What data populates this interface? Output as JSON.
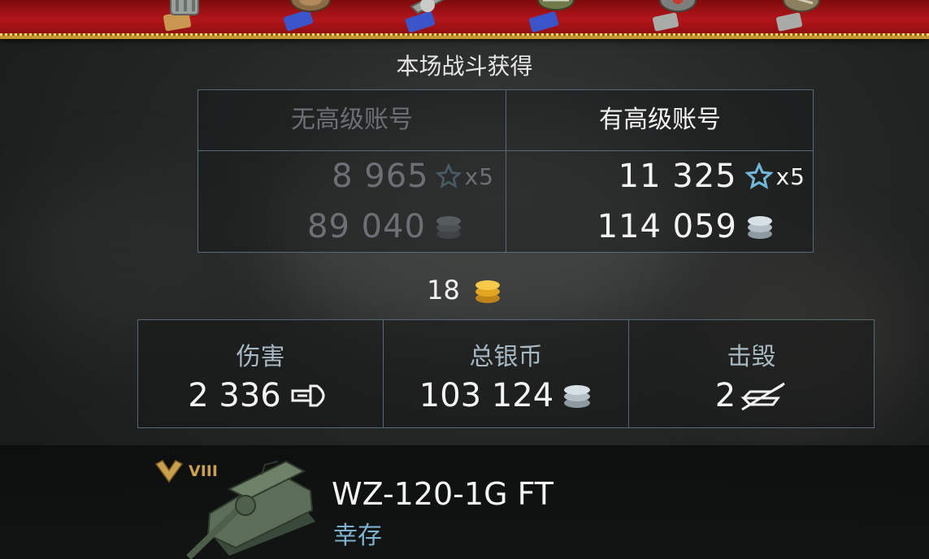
{
  "header": {
    "title": "本场战斗获得"
  },
  "medals": [
    {
      "name": "medal-1-icon"
    },
    {
      "name": "medal-2-icon"
    },
    {
      "name": "medal-3-icon"
    },
    {
      "name": "medal-4-icon"
    },
    {
      "name": "medal-5-icon"
    },
    {
      "name": "medal-6-icon"
    }
  ],
  "comparison": {
    "no_premium": {
      "label": "无高级账号",
      "experience": "8 965",
      "experience_multiplier": "x5",
      "credits": "89 040"
    },
    "premium": {
      "label": "有高级账号",
      "experience": "11 325",
      "experience_multiplier": "x5",
      "credits": "114 059"
    }
  },
  "gold": {
    "value": "18"
  },
  "stats": {
    "damage": {
      "label": "伤害",
      "value": "2 336"
    },
    "total_credits": {
      "label": "总银币",
      "value": "103 124"
    },
    "kills": {
      "label": "击毁",
      "value": "2"
    }
  },
  "vehicle": {
    "tier": "VIII",
    "name": "WZ-120-1G FT",
    "status": "幸存"
  },
  "colors": {
    "banner_red": "#b3161a",
    "banner_gold": "#c6962f",
    "panel_border": "#5a6a73",
    "star_blue": "#6fb6d8",
    "gold_coin": "#f0b62a",
    "status_blue": "#7eb0cf",
    "tier_gold": "#c9a04f"
  }
}
